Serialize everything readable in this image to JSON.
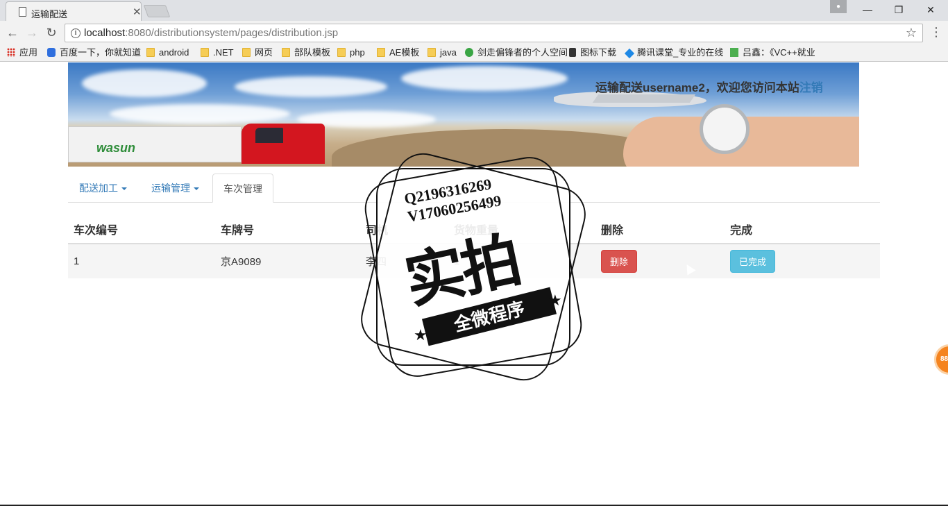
{
  "browser": {
    "tab_title": "运输配送",
    "url_host": "localhost",
    "url_path": ":8080/distributionsystem/pages/distribution.jsp",
    "window": {
      "minimize": "—",
      "restore": "❐",
      "close": "✕"
    }
  },
  "bookmarks": [
    {
      "label": "应用",
      "icon": "apps-grid-icon"
    },
    {
      "label": "百度一下，你就知道",
      "icon": "baidu-paw-icon"
    },
    {
      "label": "android",
      "icon": "folder-icon"
    },
    {
      "label": ".NET",
      "icon": "folder-icon"
    },
    {
      "label": "网页",
      "icon": "folder-icon"
    },
    {
      "label": "部队模板",
      "icon": "folder-icon"
    },
    {
      "label": "php",
      "icon": "folder-icon"
    },
    {
      "label": "AE模板",
      "icon": "folder-icon"
    },
    {
      "label": "java",
      "icon": "folder-icon"
    },
    {
      "label": "剑走偏锋者的个人空间",
      "icon": "green-c-icon"
    },
    {
      "label": "图标下载",
      "icon": "download-icon"
    },
    {
      "label": "腾讯课堂_专业的在线",
      "icon": "tencent-icon"
    },
    {
      "label": "吕鑫：《VC++就业",
      "icon": "book-icon"
    }
  ],
  "banner": {
    "logo_text": "wasun",
    "welcome_prefix": "运输配送username2，欢迎您访问本站",
    "logout_link": "注销"
  },
  "nav": {
    "tabs": [
      {
        "label": "配送加工",
        "dropdown": true
      },
      {
        "label": "运输管理",
        "dropdown": true
      },
      {
        "label": "车次管理",
        "dropdown": false,
        "active": true
      }
    ]
  },
  "table": {
    "headers": [
      "车次编号",
      "车牌号",
      "司机",
      "货物重量",
      "删除",
      "完成"
    ],
    "rows": [
      {
        "id": "1",
        "plate": "京A9089",
        "driver": "李四",
        "weight": "1",
        "delete_label": "删除",
        "done_label": "已完成"
      }
    ]
  },
  "watermark": {
    "line1": "Q2196316269",
    "line2": "V17060256499",
    "big": "实拍",
    "ribbon": "全微程序"
  },
  "side_bubble": "88"
}
